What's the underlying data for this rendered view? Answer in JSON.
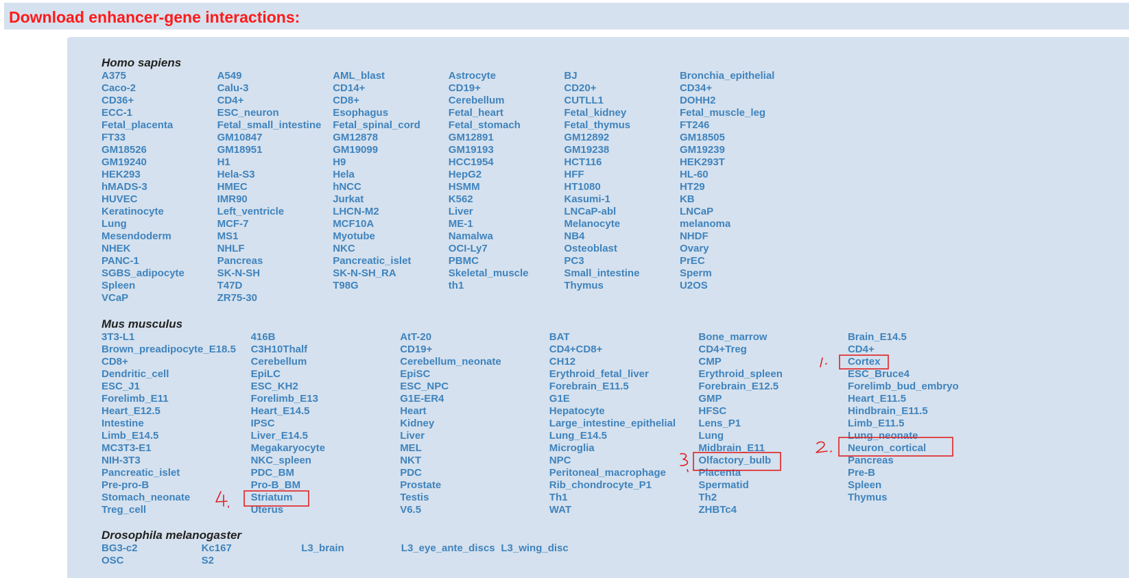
{
  "header": {
    "title": "Download enhancer-gene interactions:"
  },
  "species": {
    "homo_sapiens": {
      "name": "Homo sapiens",
      "rows": [
        [
          "A375",
          "A549",
          "AML_blast",
          "Astrocyte",
          "BJ",
          "Bronchia_epithelial"
        ],
        [
          "Caco-2",
          "Calu-3",
          "CD14+",
          "CD19+",
          "CD20+",
          "CD34+"
        ],
        [
          "CD36+",
          "CD4+",
          "CD8+",
          "Cerebellum",
          "CUTLL1",
          "DOHH2"
        ],
        [
          "ECC-1",
          "ESC_neuron",
          "Esophagus",
          "Fetal_heart",
          "Fetal_kidney",
          "Fetal_muscle_leg"
        ],
        [
          "Fetal_placenta",
          "Fetal_small_intestine",
          "Fetal_spinal_cord",
          "Fetal_stomach",
          "Fetal_thymus",
          "FT246"
        ],
        [
          "FT33",
          "GM10847",
          "GM12878",
          "GM12891",
          "GM12892",
          "GM18505"
        ],
        [
          "GM18526",
          "GM18951",
          "GM19099",
          "GM19193",
          "GM19238",
          "GM19239"
        ],
        [
          "GM19240",
          "H1",
          "H9",
          "HCC1954",
          "HCT116",
          "HEK293T"
        ],
        [
          "HEK293",
          "Hela-S3",
          "Hela",
          "HepG2",
          "HFF",
          "HL-60"
        ],
        [
          "hMADS-3",
          "HMEC",
          "hNCC",
          "HSMM",
          "HT1080",
          "HT29"
        ],
        [
          "HUVEC",
          "IMR90",
          "Jurkat",
          "K562",
          "Kasumi-1",
          "KB"
        ],
        [
          "Keratinocyte",
          "Left_ventricle",
          "LHCN-M2",
          "Liver",
          "LNCaP-abl",
          "LNCaP"
        ],
        [
          "Lung",
          "MCF-7",
          "MCF10A",
          "ME-1",
          "Melanocyte",
          "melanoma"
        ],
        [
          "Mesendoderm",
          "MS1",
          "Myotube",
          "Namalwa",
          "NB4",
          "NHDF"
        ],
        [
          "NHEK",
          "NHLF",
          "NKC",
          "OCI-Ly7",
          "Osteoblast",
          "Ovary"
        ],
        [
          "PANC-1",
          "Pancreas",
          "Pancreatic_islet",
          "PBMC",
          "PC3",
          "PrEC"
        ],
        [
          "SGBS_adipocyte",
          "SK-N-SH",
          "SK-N-SH_RA",
          "Skeletal_muscle",
          "Small_intestine",
          "Sperm"
        ],
        [
          "Spleen",
          "T47D",
          "T98G",
          "th1",
          "Thymus",
          "U2OS"
        ],
        [
          "VCaP",
          "ZR75-30"
        ]
      ]
    },
    "mus_musculus": {
      "name": "Mus musculus",
      "rows": [
        [
          "3T3-L1",
          "416B",
          "AtT-20",
          "BAT",
          "Bone_marrow",
          "Brain_E14.5"
        ],
        [
          "Brown_preadipocyte_E18.5",
          "C3H10Thalf",
          "CD19+",
          "CD4+CD8+",
          "CD4+Treg",
          "CD4+"
        ],
        [
          "CD8+",
          "Cerebellum",
          "Cerebellum_neonate",
          "CH12",
          "CMP",
          "Cortex"
        ],
        [
          "Dendritic_cell",
          "EpiLC",
          "EpiSC",
          "Erythroid_fetal_liver",
          "Erythroid_spleen",
          "ESC_Bruce4"
        ],
        [
          "ESC_J1",
          "ESC_KH2",
          "ESC_NPC",
          "Forebrain_E11.5",
          "Forebrain_E12.5",
          "Forelimb_bud_embryo"
        ],
        [
          "Forelimb_E11",
          "Forelimb_E13",
          "G1E-ER4",
          "G1E",
          "GMP",
          "Heart_E11.5"
        ],
        [
          "Heart_E12.5",
          "Heart_E14.5",
          "Heart",
          "Hepatocyte",
          "HFSC",
          "Hindbrain_E11.5"
        ],
        [
          "Intestine",
          "IPSC",
          "Kidney",
          "Large_intestine_epithelial",
          "Lens_P1",
          "Limb_E11.5"
        ],
        [
          "Limb_E14.5",
          "Liver_E14.5",
          "Liver",
          "Lung_E14.5",
          "Lung",
          "Lung_neonate"
        ],
        [
          "MC3T3-E1",
          "Megakaryocyte",
          "MEL",
          "Microglia",
          "Midbrain_E11",
          "Neuron_cortical"
        ],
        [
          "NIH-3T3",
          "NKC_spleen",
          "NKT",
          "NPC",
          "Olfactory_bulb",
          "Pancreas"
        ],
        [
          "Pancreatic_islet",
          "PDC_BM",
          "PDC",
          "Peritoneal_macrophage",
          "Placenta",
          "Pre-B"
        ],
        [
          "Pre-pro-B",
          "Pro-B_BM",
          "Prostate",
          "Rib_chondrocyte_P1",
          "Spermatid",
          "Spleen"
        ],
        [
          "Stomach_neonate",
          "Striatum",
          "Testis",
          "Th1",
          "Th2",
          "Thymus"
        ],
        [
          "Treg_cell",
          "Uterus",
          "V6.5",
          "WAT",
          "ZHBTc4"
        ]
      ]
    },
    "drosophila": {
      "name": "Drosophila melanogaster",
      "rows": [
        [
          "BG3-c2",
          "Kc167",
          "L3_brain",
          "L3_eye_ante_discs",
          "L3_wing_disc"
        ],
        [
          "OSC",
          "S2"
        ]
      ]
    }
  },
  "annotations": {
    "color": "#e02020",
    "marked_items": [
      "Cortex",
      "Neuron_cortical",
      "Olfactory_bulb",
      "Striatum"
    ],
    "marker_labels": [
      "1",
      "2",
      "3",
      "4"
    ]
  }
}
